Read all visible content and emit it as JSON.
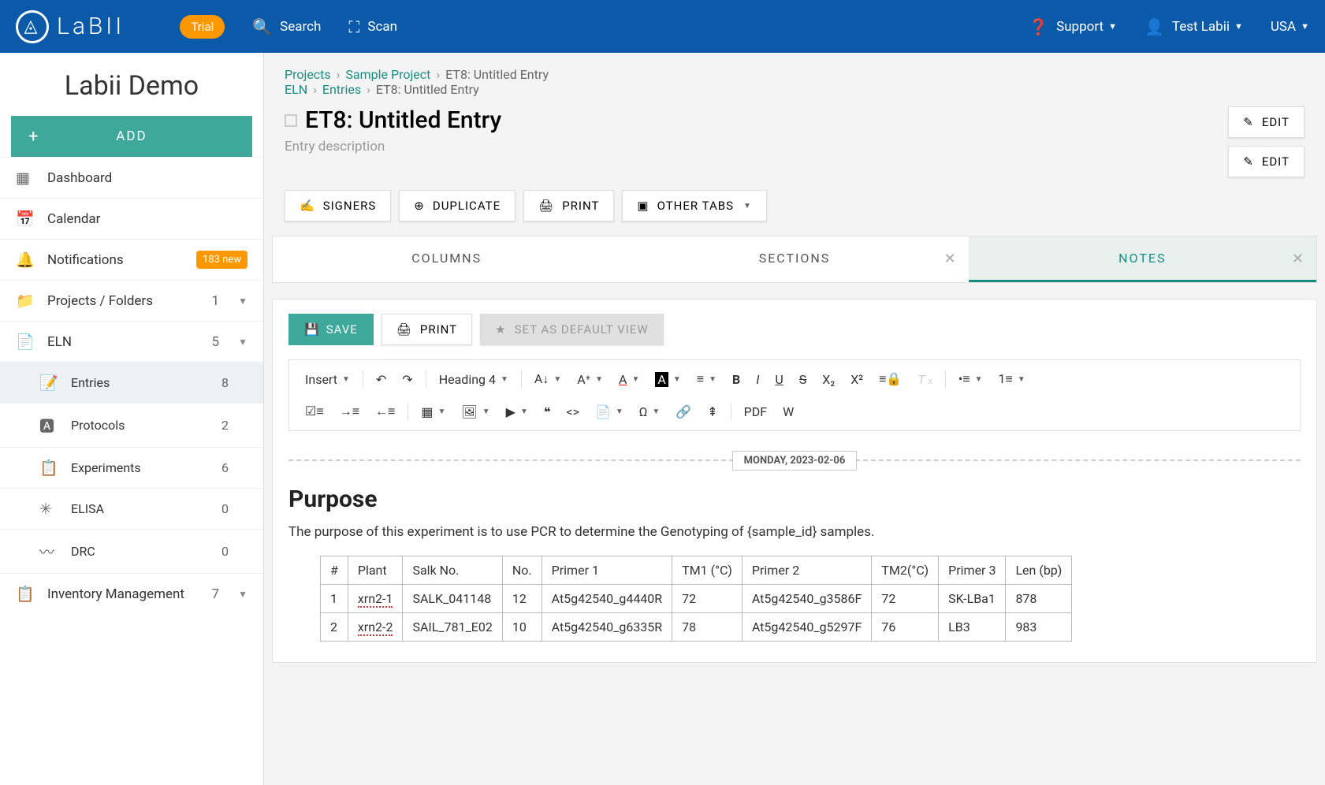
{
  "topbar": {
    "logo_text": "LaBII",
    "trial": "Trial",
    "search": "Search",
    "scan": "Scan",
    "support": "Support",
    "user": "Test Labii",
    "region": "USA"
  },
  "sidebar": {
    "org": "Labii Demo",
    "add": "ADD",
    "items": [
      {
        "icon": "▦",
        "label": "Dashboard"
      },
      {
        "icon": "📅",
        "label": "Calendar"
      },
      {
        "icon": "🔔",
        "label": "Notifications",
        "badge": "183 new"
      },
      {
        "icon": "📁",
        "label": "Projects / Folders",
        "count": "1",
        "expand": true
      },
      {
        "icon": "📄",
        "label": "ELN",
        "count": "5",
        "expand": true
      },
      {
        "icon": "📋",
        "label": "Inventory Management",
        "count": "7",
        "expand": true
      }
    ],
    "eln_children": [
      {
        "icon": "📝",
        "label": "Entries",
        "count": "8",
        "active": true
      },
      {
        "icon": "🅰",
        "label": "Protocols",
        "count": "2"
      },
      {
        "icon": "📋",
        "label": "Experiments",
        "count": "6"
      },
      {
        "icon": "✳",
        "label": "ELISA",
        "count": "0"
      },
      {
        "icon": "〰",
        "label": "DRC",
        "count": "0"
      }
    ]
  },
  "breadcrumb1": {
    "root": "Projects",
    "proj": "Sample Project",
    "entry": "ET8: Untitled Entry"
  },
  "breadcrumb2": {
    "root": "ELN",
    "section": "Entries",
    "entry": "ET8: Untitled Entry"
  },
  "entry": {
    "title": "ET8: Untitled Entry",
    "desc": "Entry description",
    "edit": "EDIT"
  },
  "actions": {
    "signers": "SIGNERS",
    "duplicate": "DUPLICATE",
    "print": "PRINT",
    "other": "OTHER TABS"
  },
  "tabs": {
    "columns": "COLUMNS",
    "sections": "SECTIONS",
    "notes": "NOTES"
  },
  "editor": {
    "save": "SAVE",
    "print": "PRINT",
    "default": "SET AS DEFAULT VIEW",
    "insert": "Insert",
    "heading": "Heading 4"
  },
  "content": {
    "date": "MONDAY, 2023-02-06",
    "h2": "Purpose",
    "p": "The purpose of this experiment is to use PCR to determine the Genotyping of {sample_id} samples."
  },
  "table": {
    "headers": [
      "#",
      "Plant",
      "Salk No.",
      "No.",
      "Primer 1",
      "TM1 (°C)",
      "Primer 2",
      "TM2(°C)",
      "Primer 3",
      "Len (bp)"
    ],
    "rows": [
      [
        "1",
        "xrn2-1",
        "SALK_041148",
        "12",
        "At5g42540_g4440R",
        "72",
        "At5g42540_g3586F",
        "72",
        "SK-LBa1",
        "878"
      ],
      [
        "2",
        "xrn2-2",
        "SAIL_781_E02",
        "10",
        "At5g42540_g6335R",
        "78",
        "At5g42540_g5297F",
        "76",
        "LB3",
        "983"
      ]
    ]
  }
}
